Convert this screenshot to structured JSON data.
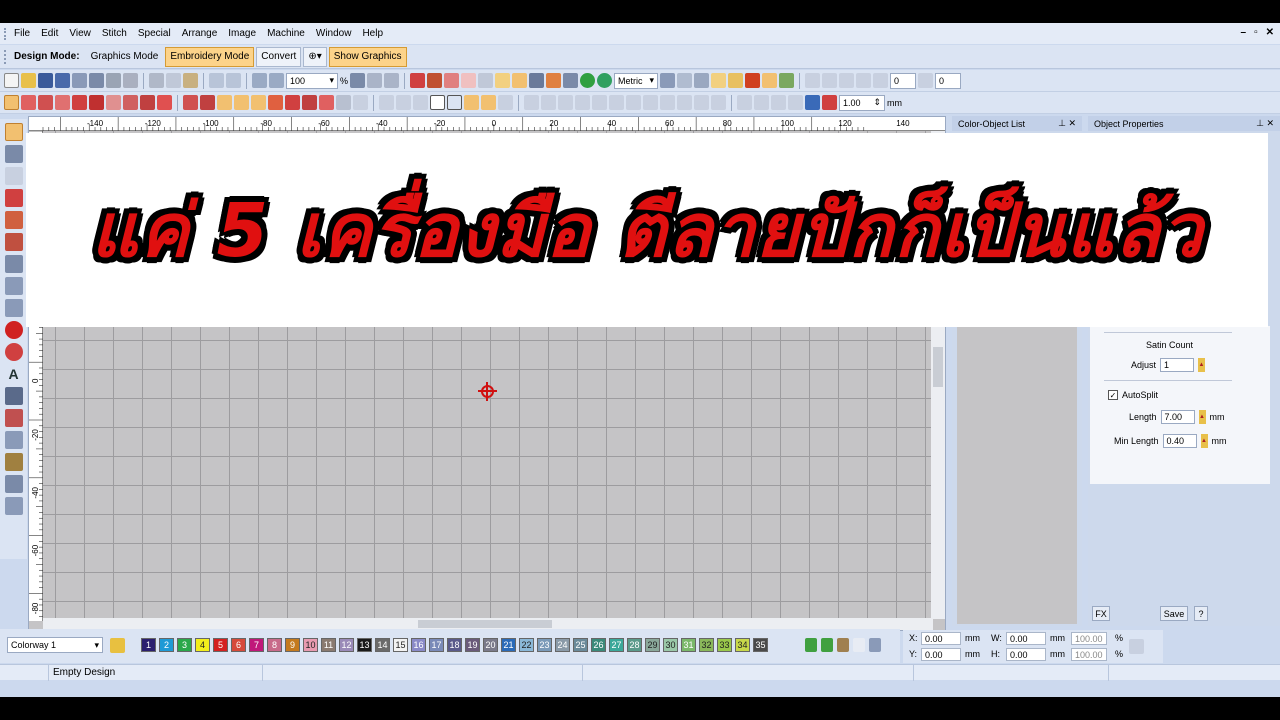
{
  "menu": [
    "File",
    "Edit",
    "View",
    "Stitch",
    "Special",
    "Arrange",
    "Image",
    "Machine",
    "Window",
    "Help"
  ],
  "modebar": {
    "label": "Design Mode:",
    "graphics_mode": "Graphics Mode",
    "embroidery_mode": "Embroidery Mode",
    "convert": "Convert",
    "show_graphics": "Show Graphics"
  },
  "toolbar": {
    "zoom_value": "100",
    "zoom_unit": "%",
    "units": "Metric",
    "num1": "0",
    "num2": "0",
    "pen_width": "1.00",
    "pen_unit": "mm"
  },
  "ruler": {
    "h_labels": [
      "-140",
      "-120",
      "-100",
      "-80",
      "-60",
      "-40",
      "-20",
      "0",
      "20",
      "40",
      "60",
      "80",
      "100",
      "120",
      "140"
    ],
    "v_labels": [
      "0",
      "-20",
      "-40",
      "-60",
      "-80"
    ]
  },
  "panels": {
    "color_object_list": "Color-Object List",
    "object_properties": "Object Properties"
  },
  "props": {
    "satin_count": "Satin Count",
    "adjust_label": "Adjust",
    "adjust_value": "1",
    "autosplit_label": "AutoSplit",
    "length_label": "Length",
    "length_value": "7.00",
    "length_unit": "mm",
    "min_length_label": "Min Length",
    "min_length_value": "0.40",
    "min_length_unit": "mm",
    "fx": "FX",
    "save": "Save",
    "help": "?"
  },
  "colorway": {
    "name": "Colorway 1",
    "swatches": [
      {
        "n": "1",
        "c": "#2a1e6e"
      },
      {
        "n": "2",
        "c": "#1f9ad6"
      },
      {
        "n": "3",
        "c": "#2aa84a"
      },
      {
        "n": "4",
        "c": "#f2ee1c"
      },
      {
        "n": "5",
        "c": "#d42020"
      },
      {
        "n": "6",
        "c": "#d64a3a"
      },
      {
        "n": "7",
        "c": "#c0187a"
      },
      {
        "n": "8",
        "c": "#c86a8a"
      },
      {
        "n": "9",
        "c": "#c47a1e"
      },
      {
        "n": "10",
        "c": "#e89ab0"
      },
      {
        "n": "11",
        "c": "#8a7a70"
      },
      {
        "n": "12",
        "c": "#9a8ab8"
      },
      {
        "n": "13",
        "c": "#1a1a1a"
      },
      {
        "n": "14",
        "c": "#6a6a6a"
      },
      {
        "n": "15",
        "c": "#f2f2f2"
      },
      {
        "n": "16",
        "c": "#8a8ac8"
      },
      {
        "n": "17",
        "c": "#7a8ab8"
      },
      {
        "n": "18",
        "c": "#5a5a8a"
      },
      {
        "n": "19",
        "c": "#6a5a7a"
      },
      {
        "n": "20",
        "c": "#7a7a8a"
      },
      {
        "n": "21",
        "c": "#2a6ab8"
      },
      {
        "n": "22",
        "c": "#8ab8d8"
      },
      {
        "n": "23",
        "c": "#7a9ab8"
      },
      {
        "n": "24",
        "c": "#8a9aa8"
      },
      {
        "n": "25",
        "c": "#6a8a9a"
      },
      {
        "n": "26",
        "c": "#3a8a7a"
      },
      {
        "n": "27",
        "c": "#3aa89a"
      },
      {
        "n": "28",
        "c": "#5a9a8a"
      },
      {
        "n": "29",
        "c": "#8aa89a"
      },
      {
        "n": "30",
        "c": "#9ac8a8"
      },
      {
        "n": "31",
        "c": "#7ab86a"
      },
      {
        "n": "32",
        "c": "#8ab85a"
      },
      {
        "n": "33",
        "c": "#9ac84a"
      },
      {
        "n": "34",
        "c": "#c8d84a"
      },
      {
        "n": "35",
        "c": "#4a4a4a"
      }
    ]
  },
  "coords": {
    "x_label": "X:",
    "x_value": "0.00",
    "x_unit": "mm",
    "y_label": "Y:",
    "y_value": "0.00",
    "y_unit": "mm",
    "w_label": "W:",
    "w_value": "0.00",
    "w_unit": "mm",
    "h_label": "H:",
    "h_value": "0.00",
    "h_unit": "mm",
    "sx_value": "100.00",
    "sy_value": "100.00",
    "pct": "%"
  },
  "status": {
    "text": "Empty Design"
  },
  "banner": {
    "text": "แค่ 5 เครื่องมือ ตีลายปักก็เป็นแล้ว"
  }
}
